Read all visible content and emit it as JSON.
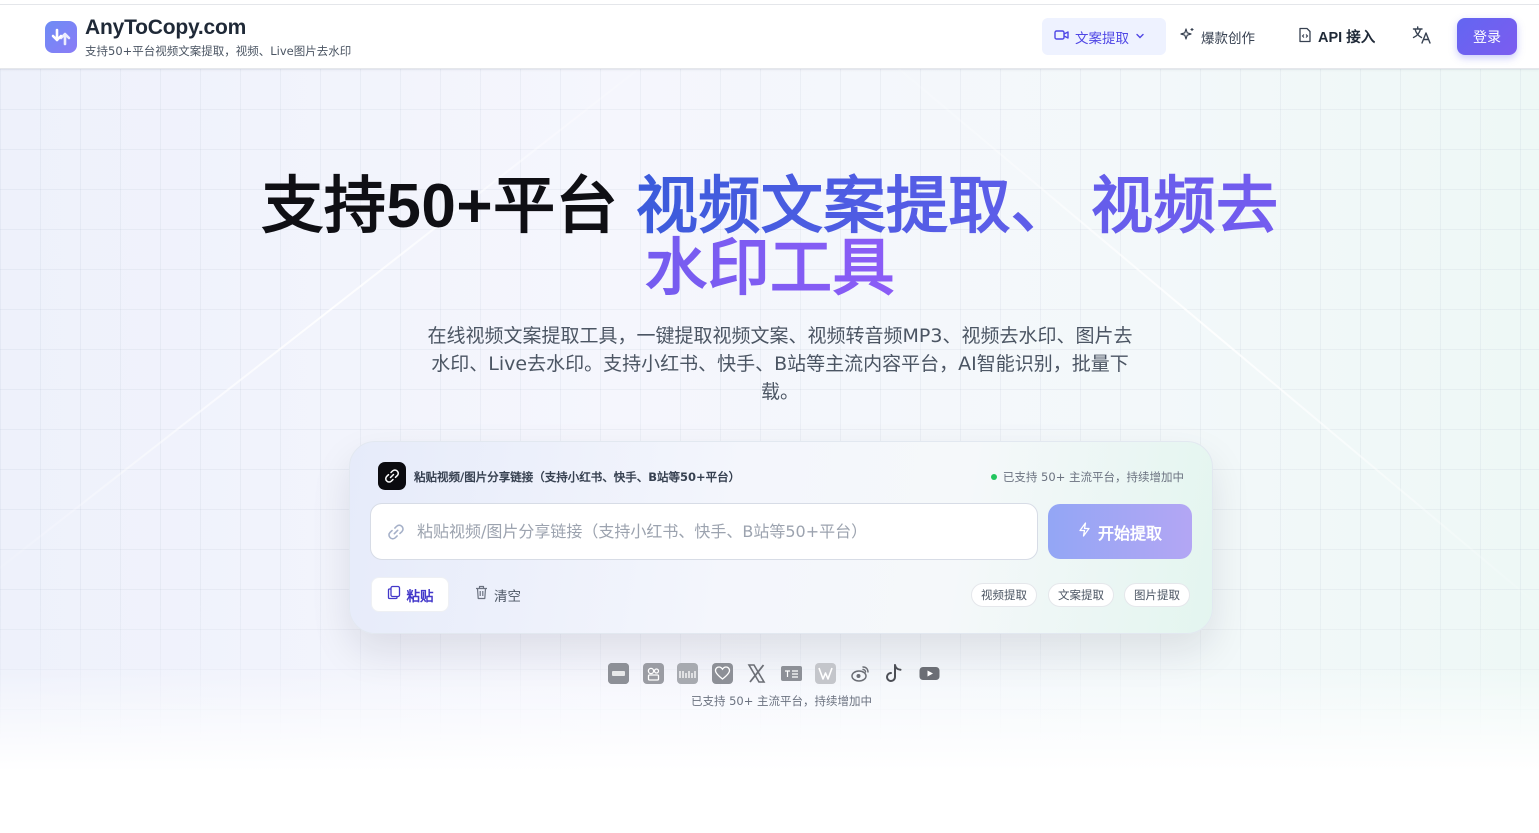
{
  "header": {
    "brand_name": "AnyToCopy.com",
    "brand_subtitle": "支持50+平台视频文案提取，视频、Live图片去水印",
    "nav": {
      "video_extract": "文案提取",
      "viral_create": "爆款创作",
      "api": "API 接入"
    },
    "login_label": "登录"
  },
  "hero": {
    "title_plain": "支持50+平台 ",
    "title_gradient": "视频文案提取、 视频去水印工具",
    "description": "在线视频文案提取工具，一键提取视频文案、视频转音频MP3、视频去水印、图片去水印、Live去水印。支持小红书、快手、B站等主流内容平台，AI智能识别，批量下载。"
  },
  "extract_card": {
    "label": "粘贴视频/图片分享链接（支持小红书、快手、B站等50+平台）",
    "status": "已支持 50+ 主流平台，持续增加中",
    "input_placeholder": "粘贴视频/图片分享链接（支持小红书、快手、B站等50+平台）",
    "input_value": "",
    "start_button": "开始提取",
    "paste_button": "粘贴",
    "clear_button": "清空",
    "chips": [
      "视频提取",
      "文案提取",
      "图片提取"
    ]
  },
  "platforms": {
    "icons": [
      "douyin-icon",
      "kuaishou-icon",
      "bilibili-icon",
      "xiaohongshu-icon",
      "x-icon",
      "toutiao-icon",
      "haokan-icon",
      "weibo-icon",
      "tiktok-icon",
      "youtube-icon"
    ],
    "note": "已支持 50+ 主流平台，持续增加中"
  },
  "colors": {
    "accent": "#6366f1",
    "accent_light": "#eef2ff",
    "status_green": "#22c55e"
  }
}
